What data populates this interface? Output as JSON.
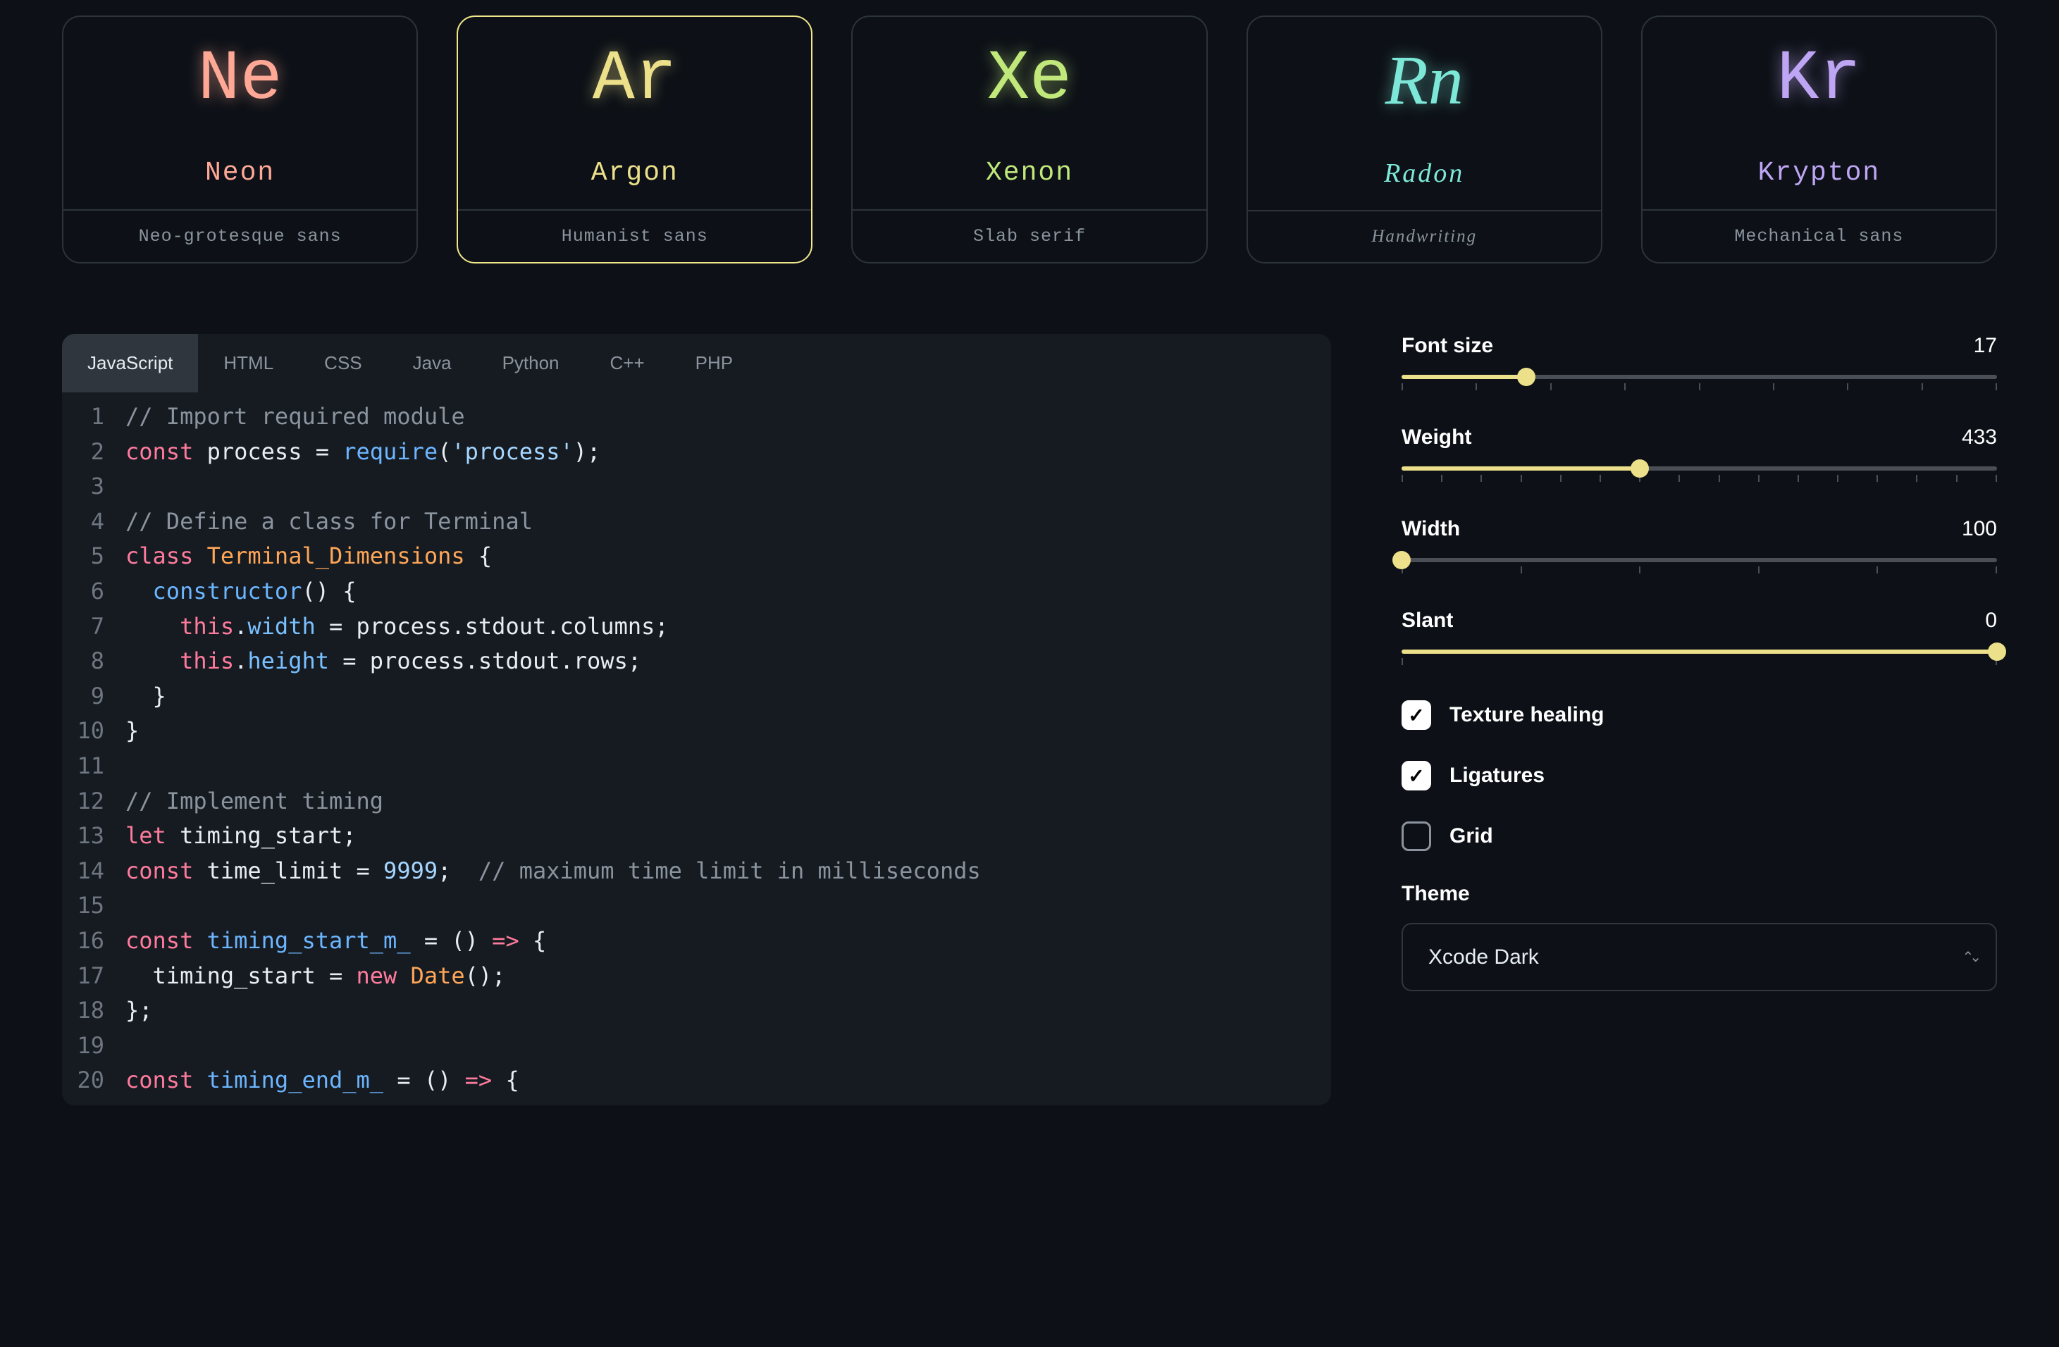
{
  "fonts": [
    {
      "symbol": "Ne",
      "name": "Neon",
      "style": "Neo-grotesque sans",
      "color": "neon"
    },
    {
      "symbol": "Ar",
      "name": "Argon",
      "style": "Humanist sans",
      "color": "argon",
      "selected": true
    },
    {
      "symbol": "Xe",
      "name": "Xenon",
      "style": "Slab serif",
      "color": "xenon"
    },
    {
      "symbol": "Rn",
      "name": "Radon",
      "style": "Handwriting",
      "color": "radon"
    },
    {
      "symbol": "Kr",
      "name": "Krypton",
      "style": "Mechanical sans",
      "color": "krypton"
    }
  ],
  "tabs": [
    "JavaScript",
    "HTML",
    "CSS",
    "Java",
    "Python",
    "C++",
    "PHP"
  ],
  "active_tab": "JavaScript",
  "code": [
    [
      [
        "cm",
        "// Import required module"
      ]
    ],
    [
      [
        "kw",
        "const"
      ],
      [
        "id",
        " process "
      ],
      [
        "id",
        "= "
      ],
      [
        "fn",
        "require"
      ],
      [
        "id",
        "("
      ],
      [
        "str",
        "'process'"
      ],
      [
        "id",
        ");"
      ]
    ],
    [],
    [
      [
        "cm",
        "// Define a class for Terminal"
      ]
    ],
    [
      [
        "kw",
        "class"
      ],
      [
        "id",
        " "
      ],
      [
        "cls",
        "Terminal_Dimensions"
      ],
      [
        "id",
        " {"
      ]
    ],
    [
      [
        "id",
        "  "
      ],
      [
        "fn",
        "constructor"
      ],
      [
        "id",
        "() {"
      ]
    ],
    [
      [
        "id",
        "    "
      ],
      [
        "kw",
        "this"
      ],
      [
        "id",
        "."
      ],
      [
        "pr",
        "width"
      ],
      [
        "id",
        " = process.stdout.columns;"
      ]
    ],
    [
      [
        "id",
        "    "
      ],
      [
        "kw",
        "this"
      ],
      [
        "id",
        "."
      ],
      [
        "pr",
        "height"
      ],
      [
        "id",
        " = process.stdout.rows;"
      ]
    ],
    [
      [
        "id",
        "  }"
      ]
    ],
    [
      [
        "id",
        "}"
      ]
    ],
    [],
    [
      [
        "cm",
        "// Implement timing"
      ]
    ],
    [
      [
        "kw",
        "let"
      ],
      [
        "id",
        " timing_start;"
      ]
    ],
    [
      [
        "kw",
        "const"
      ],
      [
        "id",
        " time_limit = "
      ],
      [
        "num",
        "9999"
      ],
      [
        "id",
        ";  "
      ],
      [
        "cm",
        "// maximum time limit in milliseconds"
      ]
    ],
    [],
    [
      [
        "kw",
        "const"
      ],
      [
        "id",
        " "
      ],
      [
        "fn",
        "timing_start_m_"
      ],
      [
        "id",
        " = () "
      ],
      [
        "kw",
        "=>"
      ],
      [
        "id",
        " {"
      ]
    ],
    [
      [
        "id",
        "  timing_start = "
      ],
      [
        "kw",
        "new"
      ],
      [
        "id",
        " "
      ],
      [
        "cls",
        "Date"
      ],
      [
        "id",
        "();"
      ]
    ],
    [
      [
        "id",
        "};"
      ]
    ],
    [],
    [
      [
        "kw",
        "const"
      ],
      [
        "id",
        " "
      ],
      [
        "fn",
        "timing_end_m_"
      ],
      [
        "id",
        " = () "
      ],
      [
        "kw",
        "=>"
      ],
      [
        "id",
        " {"
      ]
    ]
  ],
  "controls": {
    "font_size": {
      "label": "Font size",
      "value": "17",
      "pct": 21
    },
    "weight": {
      "label": "Weight",
      "value": "433",
      "pct": 40
    },
    "width": {
      "label": "Width",
      "value": "100",
      "pct": 0
    },
    "slant": {
      "label": "Slant",
      "value": "0",
      "pct": 100
    }
  },
  "checkboxes": {
    "texture": {
      "label": "Texture healing",
      "checked": true
    },
    "ligatures": {
      "label": "Ligatures",
      "checked": true
    },
    "grid": {
      "label": "Grid",
      "checked": false
    }
  },
  "theme": {
    "label": "Theme",
    "value": "Xcode Dark"
  }
}
